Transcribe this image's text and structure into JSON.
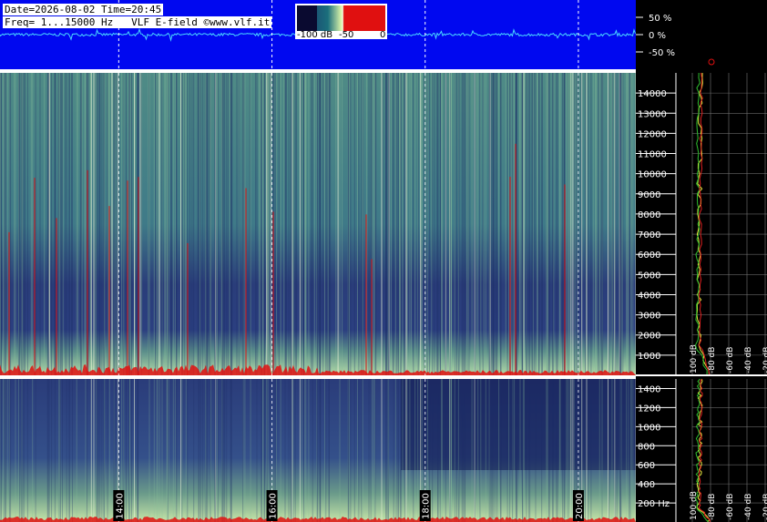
{
  "header": {
    "date_line": "Date=2026-08-02 Time=20:45",
    "freq_line": "Freq= 1...15000 Hz   VLF E-field ©www.vlf.it"
  },
  "colors": {
    "wave_bg": "#0008f0",
    "wave_trace": "#49d9ff",
    "spectrum_low": "#1a2a6a",
    "spectrum_high": "#d8f3a8",
    "peak_red": "#e01010",
    "profile_avg": "#e8e840",
    "profile_min": "#30c030",
    "profile_max": "#e02020"
  },
  "legend": {
    "labels": [
      "-100 dB",
      "-50",
      "0"
    ],
    "range_db": [
      -100,
      0
    ]
  },
  "chart_data": [
    {
      "type": "line",
      "name": "waveform",
      "y_tick_labels": [
        "50 %",
        "0 %",
        "-50 %"
      ],
      "y_ticks": [
        50,
        0,
        -50
      ],
      "ylim": [
        -100,
        100
      ]
    },
    {
      "type": "heatmap",
      "name": "spectrogram-full",
      "ylim": [
        0,
        15000
      ],
      "y_tick_labels": [
        "1000",
        "2000",
        "3000",
        "4000",
        "5000",
        "6000",
        "7000",
        "8000",
        "9000",
        "10000",
        "11000",
        "12000",
        "13000",
        "14000"
      ],
      "y_ticks": [
        1000,
        2000,
        3000,
        4000,
        5000,
        6000,
        7000,
        8000,
        9000,
        10000,
        11000,
        12000,
        13000,
        14000
      ],
      "xlim": [
        12.45,
        20.75
      ],
      "time_grid": [
        14,
        16,
        18,
        20
      ],
      "profile_x_labels": [
        "100 dB",
        "-80 dB",
        "-60 dB",
        "-40 dB",
        "-20 dB"
      ],
      "profile_x_ticks": [
        -100,
        -80,
        -60,
        -40,
        -20
      ]
    },
    {
      "type": "heatmap",
      "name": "spectrogram-low",
      "ylim": [
        0,
        1500
      ],
      "y_tick_labels": [
        "200 Hz",
        "400",
        "600",
        "800",
        "1000",
        "1200",
        "1400"
      ],
      "y_ticks": [
        200,
        400,
        600,
        800,
        1000,
        1200,
        1400
      ],
      "xlim": [
        12.45,
        20.75
      ],
      "time_labels": [
        "14:00",
        "16:00",
        "18:00",
        "20:00"
      ],
      "time_ticks": [
        14,
        16,
        18,
        20
      ],
      "profile_x_labels": [
        "100 dB",
        "-80 dB",
        "-60 dB",
        "-40 dB",
        "-20 dB"
      ],
      "profile_x_ticks": [
        -100,
        -80,
        -60,
        -40,
        -20
      ]
    }
  ]
}
